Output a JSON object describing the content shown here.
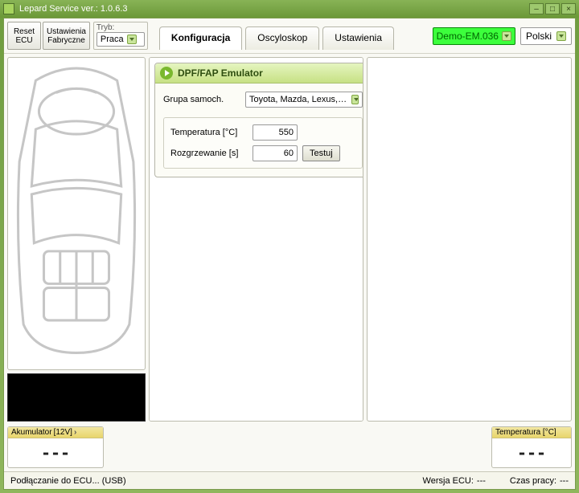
{
  "window": {
    "title": "Lepard Service  ver.: 1.0.6.3"
  },
  "toolbar": {
    "reset_ecu": "Reset\nECU",
    "factory_settings": "Ustawienia\nFabryczne",
    "mode_label": "Tryb:",
    "mode_value": "Praca"
  },
  "tabs": {
    "config": "Konfiguracja",
    "oscilloscope": "Oscyloskop",
    "settings": "Ustawienia"
  },
  "device": {
    "label": "Demo-EM.036"
  },
  "language": {
    "label": "Polski"
  },
  "group": {
    "title": "DPF/FAP Emulator",
    "car_group_label": "Grupa samoch.",
    "car_group_value": "Toyota, Mazda, Lexus, Nissan (Denso)",
    "temperature_label": "Temperatura [°C]",
    "temperature_value": "550",
    "warmup_label": "Rozgrzewanie [s]",
    "warmup_value": "60",
    "test_button": "Testuj"
  },
  "gauges": {
    "battery_label": "Akumulator",
    "battery_val_label": "12V",
    "battery_value": "---",
    "temperature_label": "Temperatura [°C]",
    "temperature_value": "---"
  },
  "status": {
    "connecting": "Podłączanie do ECU... (USB)",
    "ecu_version_label": "Wersja ECU:",
    "ecu_version_value": "---",
    "uptime_label": "Czas pracy:",
    "uptime_value": "---"
  }
}
